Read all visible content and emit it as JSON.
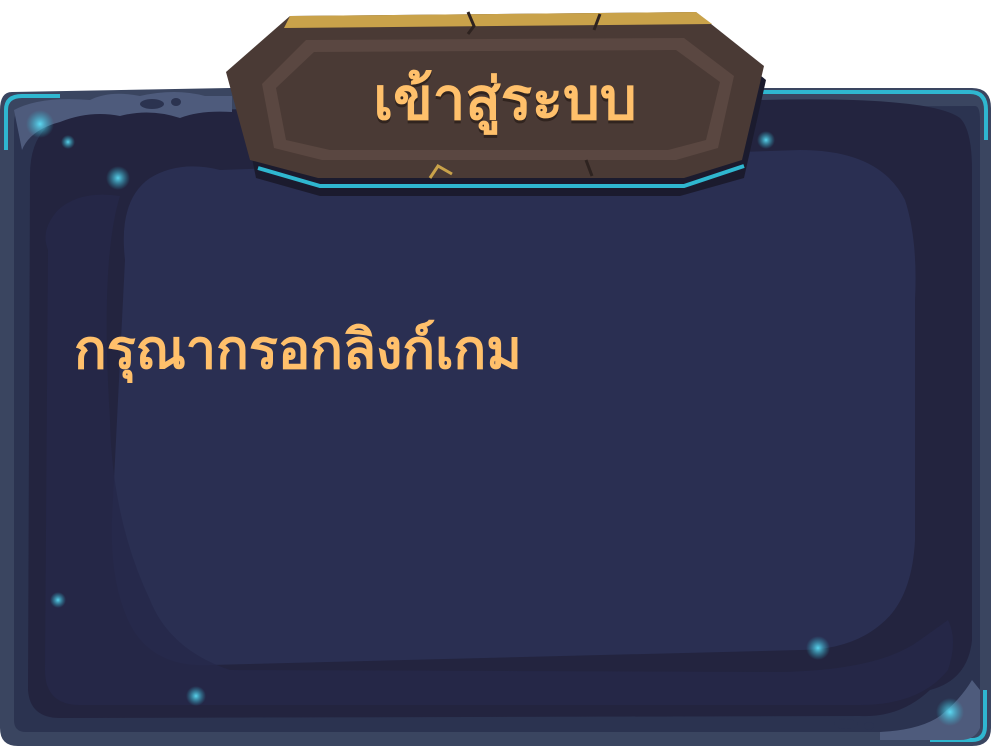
{
  "dialog": {
    "title": "เข้าสู่ระบบ",
    "message": "กรุณากรอกลิงก์เกม"
  },
  "theme": {
    "frame_outer": "#3a4560",
    "frame_rim": "#5c6b8a",
    "panel_dark": "#23243f",
    "panel_inner": "#2a2f52",
    "accent_cyan": "#2fb7d0",
    "plaque_wood": "#4a3a35",
    "plaque_gold": "#c9a24a",
    "text_gold": "#ffc06b"
  }
}
